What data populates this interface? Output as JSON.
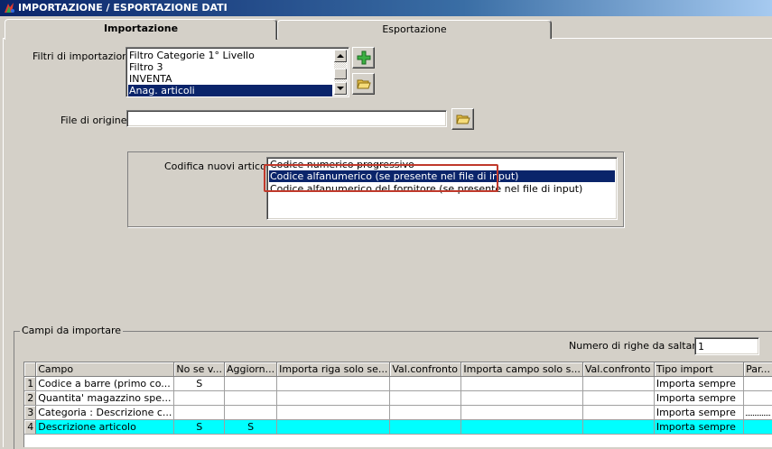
{
  "window": {
    "title": "IMPORTAZIONE / ESPORTAZIONE DATI"
  },
  "tabs": [
    {
      "label": "Importazione",
      "active": true
    },
    {
      "label": "Esportazione",
      "active": false
    }
  ],
  "filters": {
    "label": "Filtri di importazione :",
    "items": [
      "Filtro Categorie 1° Livello",
      "Filtro 3",
      "INVENTA",
      "Anag. articoli"
    ],
    "selected": "Anag. articoli"
  },
  "source_file": {
    "label": "File di origine :",
    "value": ""
  },
  "coding": {
    "label": "Codifica nuovi articoli :",
    "items": [
      "Codice numerico progressivo",
      "Codice alfanumerico (se presente nel file di input)",
      "Codice alfanumerico del fornitore (se presente nel file di input)"
    ],
    "selected": "Codice alfanumerico (se presente nel file di input)",
    "highlight_color": "#c0392b"
  },
  "fields_group": {
    "label": "Campi da importare",
    "skip_rows_label": "Numero di righe da saltare :",
    "skip_rows_value": "1"
  },
  "grid": {
    "columns": [
      "Campo",
      "No se v...",
      "Aggiorn...",
      "Importa riga solo se...",
      "Val.confronto",
      "Importa campo solo s...",
      "Val.confronto",
      "Tipo import",
      "Par..."
    ],
    "rows": [
      {
        "n": "1",
        "campo": "Codice a barre (primo co...",
        "nosev": "S",
        "aggiorn": "",
        "tipo": "Importa sempre"
      },
      {
        "n": "2",
        "campo": "Quantita' magazzino spe...",
        "nosev": "",
        "aggiorn": "",
        "tipo": "Importa sempre"
      },
      {
        "n": "3",
        "campo": "Categoria : Descrizione c...",
        "nosev": "",
        "aggiorn": "",
        "tipo": "Importa sempre"
      },
      {
        "n": "4",
        "campo": "Descrizione articolo",
        "nosev": "S",
        "aggiorn": "S",
        "tipo": "Importa sempre"
      }
    ],
    "highlight_row_color": "#00ffff"
  },
  "icons": {
    "app": "app-icon",
    "add_filter": "add-icon",
    "open_filter": "folder-icon",
    "browse_file": "folder-icon",
    "scroll_up": "chevron-up-icon",
    "scroll_down": "chevron-down-icon"
  }
}
